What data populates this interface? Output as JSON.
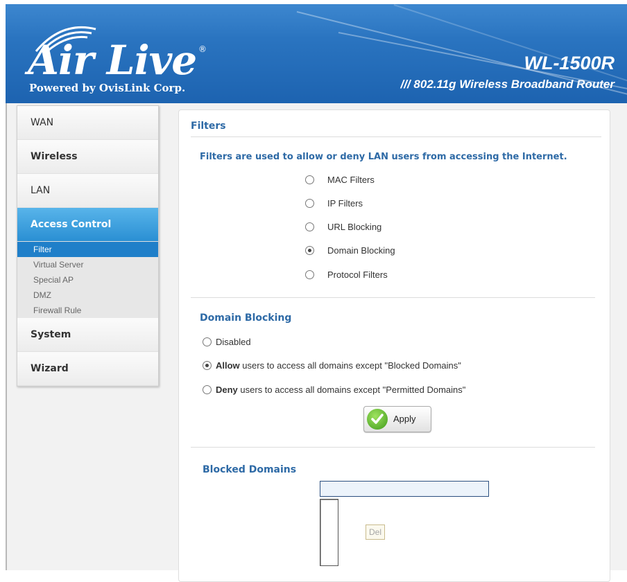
{
  "header": {
    "logo_text": "Air Live",
    "logo_reg": "®",
    "powered_by": "Powered by OvisLink Corp.",
    "model": "WL-1500R",
    "model_subtitle": "/// 802.11g Wireless Broadband Router",
    "colors": {
      "bar": "#2a74c0",
      "accent": "#2e6aa6"
    }
  },
  "sidebar": {
    "items": [
      {
        "label": "WAN"
      },
      {
        "label": "Wireless"
      },
      {
        "label": "LAN"
      },
      {
        "label": "Access Control"
      },
      {
        "label": "System"
      },
      {
        "label": "Wizard"
      }
    ],
    "sub_items": [
      {
        "label": "Filter"
      },
      {
        "label": "Virtual Server"
      },
      {
        "label": "Special AP"
      },
      {
        "label": "DMZ"
      },
      {
        "label": "Firewall Rule"
      }
    ]
  },
  "filters": {
    "title": "Filters",
    "intro": "Filters are used to allow or deny LAN users from accessing the Internet.",
    "options": [
      {
        "label": "MAC Filters",
        "selected": false
      },
      {
        "label": "IP Filters",
        "selected": false
      },
      {
        "label": "URL Blocking",
        "selected": false
      },
      {
        "label": "Domain Blocking",
        "selected": true
      },
      {
        "label": "Protocol Filters",
        "selected": false
      }
    ]
  },
  "domain_blocking": {
    "title": "Domain Blocking",
    "disabled_label": "Disabled",
    "allow_bold": "Allow",
    "allow_rest": " users to access all domains except \"Blocked Domains\"",
    "deny_bold": "Deny",
    "deny_rest": " users to access all domains except \"Permitted Domains\"",
    "selected": "allow",
    "apply_label": "Apply"
  },
  "blocked_domains": {
    "title": "Blocked Domains",
    "input_value": "",
    "del_label": "Del"
  }
}
